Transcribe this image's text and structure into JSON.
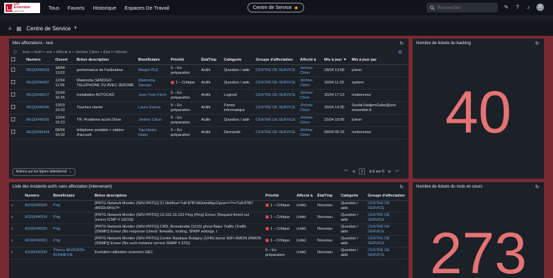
{
  "topbar": {
    "logo_line1": "Est",
    "logo_line2": "Ensemble",
    "logo_sub": "grand paris",
    "nav": [
      "Tous",
      "Favoris",
      "Historique",
      "Espaces De Travail"
    ],
    "center_label": "Centre de Service",
    "search_placeholder": "Rechercher",
    "avatar_initials": "JC"
  },
  "subbar": {
    "title": "Centre de Service"
  },
  "assignments": {
    "title": "Mes affectations - test",
    "filter": "tous > Actif = vrai > Affecté à = Jérôme Cléon > État != Résolu",
    "columns": [
      "Numéro",
      "Ouvert",
      "Brève description",
      "Bénéficiaire",
      "Priorité",
      "ÉtatTmp",
      "Catégorie",
      "Groupe d'affectation",
      "Affecté à",
      "Mis à jour ▼",
      "Mis à jour par"
    ],
    "rows": [
      {
        "num": "REQ0046599",
        "opened": "18/04 13:02",
        "desc": "performance de l'ordinateur",
        "benef": "Margot PLE",
        "prio": "5 – En préparation",
        "crit": false,
        "state": "Actifs",
        "cat": "Question / aide",
        "group": "CENTRE DE SERVICE",
        "assigned": "Jérôme Cléon",
        "updated": "18/04 13:08",
        "by": "jcleon"
      },
      {
        "num": "REQ0046497",
        "opened": "12/04 11:09",
        "desc": "Mateneba SANOGO - TELEPHONE VU AVEC JEROME",
        "benef": "Mateneba Sanogo",
        "prio": "1 – Critique",
        "crit": true,
        "state": "Actifs",
        "cat": "Question / aide",
        "group": "CENTRE DE SERVICE",
        "assigned": "Jérôme Cléon",
        "updated": "16/04 11:35",
        "by": "system"
      },
      {
        "num": "REQ0046537",
        "opened": "15/04 16:45",
        "desc": "Installation AUTOCAD",
        "benef": "Jean-Yves Floch",
        "prio": "5 – En préparation",
        "crit": false,
        "state": "Actifs",
        "cat": "Logiciel",
        "group": "CENTRE DE SERVICE",
        "assigned": "Jérôme Cléon",
        "updated": "15/04 17:13",
        "by": "mobennour"
      },
      {
        "num": "REQ0046040",
        "opened": "13/03 10:02",
        "desc": "Touches clavier",
        "benef": "Laura Esteve",
        "prio": "5 – En préparation",
        "crit": false,
        "state": "Actifs",
        "cat": "Panne informatique",
        "group": "CENTRE DE SERVICE",
        "assigned": "Jérôme Cléon",
        "updated": "15/04 14:35",
        "by": "Souhil.HadjemGabsi@est-ensemble.fr"
      },
      {
        "num": "REQ0046505",
        "opened": "12/04 15:23",
        "desc": "TR: Problème accès Drive",
        "benef": "Jérôme Cléon",
        "prio": "5 – En préparation",
        "crit": false,
        "state": "Actifs",
        "cat": "Question / aide",
        "group": "CENTRE DE SERVICE",
        "assigned": "Jérôme Cléon",
        "updated": "15/04 10:09",
        "by": "jcleon"
      },
      {
        "num": "REQ0046444",
        "opened": "08/04 16:02",
        "desc": "téléphone portable + station d'accueil",
        "benef": "Tiguidanke Diaby",
        "prio": "5 – En préparation",
        "crit": false,
        "state": "Actifs",
        "cat": "Demande",
        "group": "CENTRE DE SERVICE",
        "assigned": "Jérôme Cléon",
        "updated": "09/04 05:15",
        "by": "mobennour"
      }
    ],
    "actions_label": "Actions sur les lignes sélectionné",
    "page_current": "1",
    "page_text": "à 6 sur 6"
  },
  "backlog": {
    "title": "Nombre de tickets du backlog",
    "value": "40"
  },
  "incidents": {
    "title": "Liste des incidents actifs sans affectation (intervenant)",
    "columns": [
      "Numéro",
      "Bénéficiaire",
      "Brève description",
      "Priorité",
      "Affecté à",
      "ÉtatTmp",
      "Catégorie",
      "Groupe d'affectation"
    ],
    "rows": [
      {
        "num": "ASS0046595",
        "benef": "Prtg",
        "desc": "[PRTG Network Monitor (SRV-PRTG)] 21 Notifica=?utf-8?B?dGlvbnMgcOpcw==?==?utf-8?B?dW3DcWVu?=",
        "prio": "1 – Critique",
        "crit": true,
        "assigned": "(vide)",
        "state": "Nouveau",
        "cat": "Question / aide",
        "group": "CENTRE DE SERVICE"
      },
      {
        "num": "ASS0046594",
        "benef": "Prtg",
        "desc": "[PRTG Network Monitor (SRV-PRTG)] 10.102.16.152 Ping (Ping) Erreur (Request timed out (erreur ICMP # 11010))",
        "prio": "1 – Critique",
        "crit": true,
        "assigned": "(vide)",
        "state": "Nouveau",
        "cat": "Question / aide",
        "group": "CENTRE DE SERVICE"
      },
      {
        "num": "ASS0046590",
        "benef": "Prtg",
        "desc": "[PRTG Network Monitor (SRV-PRTG)] CRD_Romainville (1015) ghost filaire Traffic (Traffic (SNMP)) Erreur (No response (check: firewalls, routing, SNMP settings, I",
        "prio": "1 – Critique",
        "crit": true,
        "assigned": "(vide)",
        "state": "Nouveau",
        "cat": "Question / aide",
        "group": "CENTRE DE SERVICE"
      },
      {
        "num": "ASS0046591",
        "benef": "Prtg",
        "desc": "[PRTG Network Monitor (SRV-PRTG)] Centre Nautique Bobigny (1045) borne WIFI RMON (RMON (SNMP)) Erreur (No such instance (erreur SNMP # 223))",
        "prio": "1 – Critique",
        "crit": true,
        "assigned": "(vide)",
        "state": "Nouveau",
        "cat": "Question / aide",
        "group": "CENTRE DE SERVICE"
      },
      {
        "num": "ASS0046596",
        "benef": "Thierry MOISSON-BONNEVIE",
        "desc": "Evolution utilisation scanners GEC",
        "prio": "5 – En préparation",
        "crit": false,
        "assigned": "(vide)",
        "state": "Nouveau",
        "cat": "Question / aide",
        "group": "CENTRE DE SERVICE"
      }
    ]
  },
  "month": {
    "title": "Nombre de tickets du mois en cours",
    "value": "273"
  }
}
